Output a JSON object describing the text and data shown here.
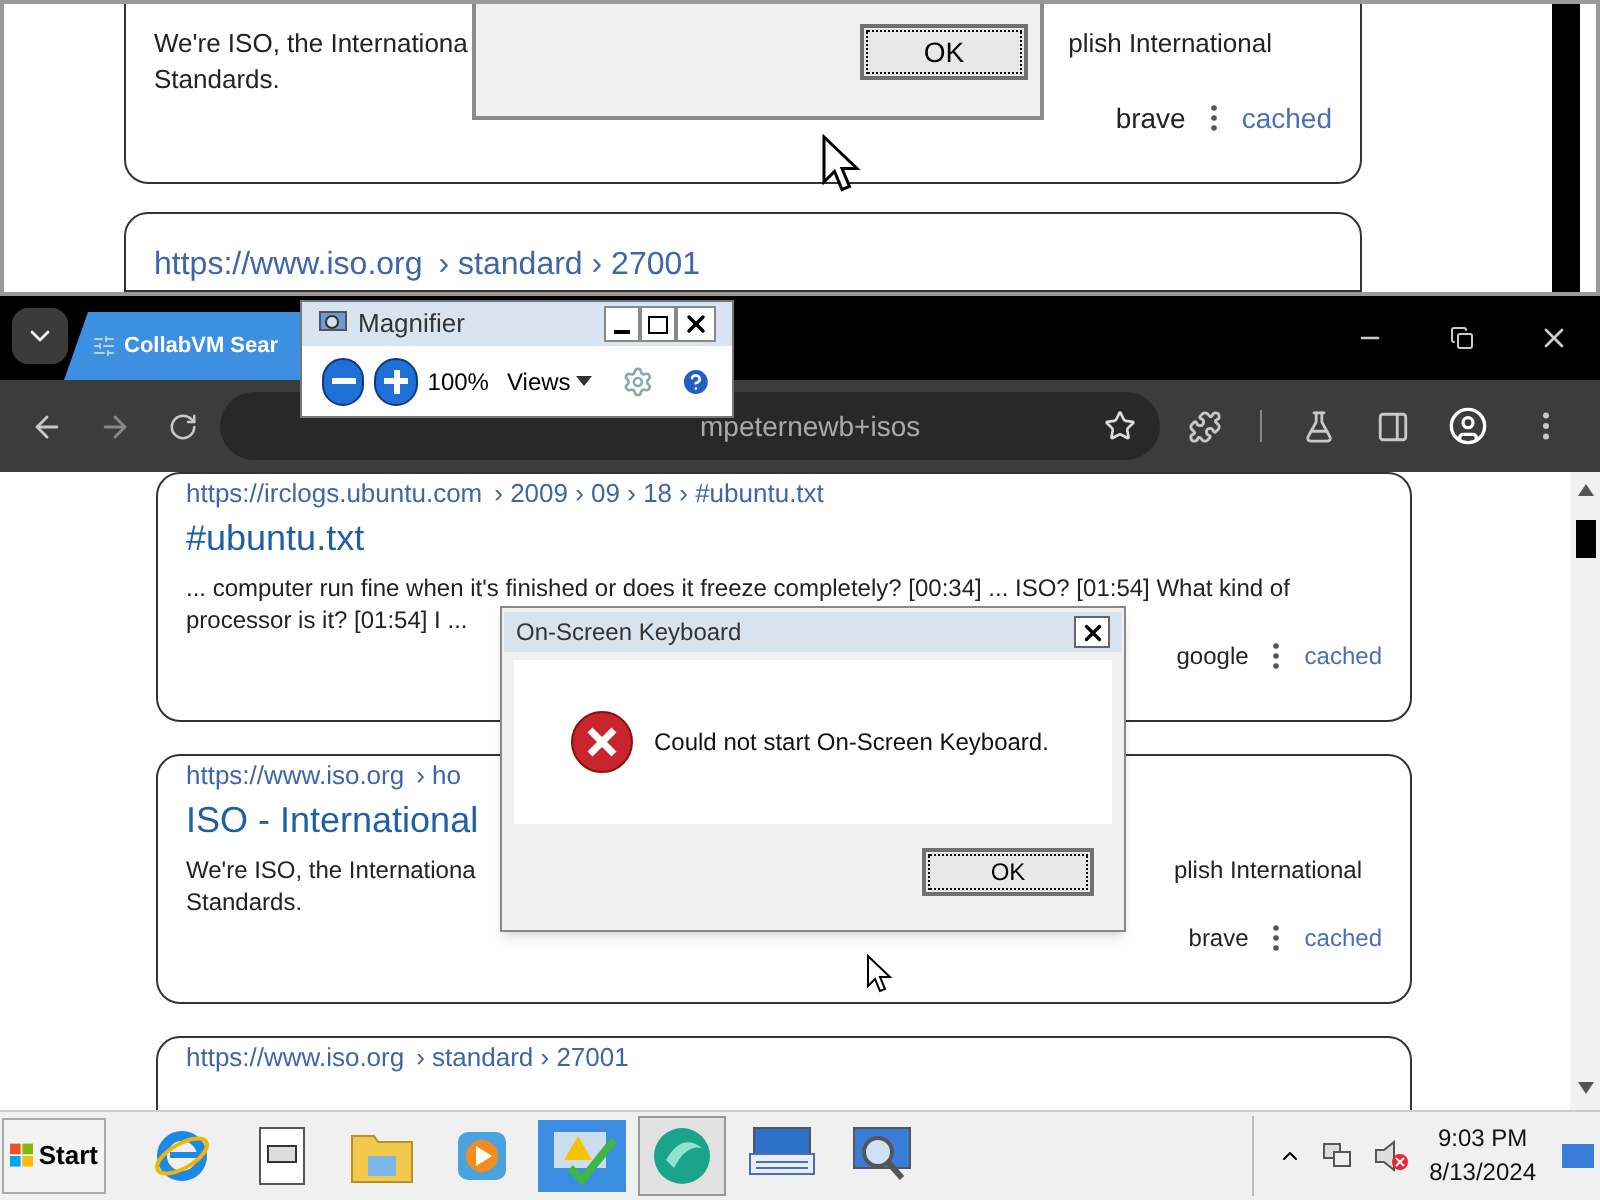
{
  "magnified_view": {
    "card_1": {
      "lines": [
        {
          "left": "We're ISO, the Internationa",
          "right": "plish International"
        },
        {
          "left": "Standards."
        }
      ],
      "source": "brave",
      "cached_link": "cached"
    },
    "dialog_button": "OK",
    "card_2": {
      "url": "https://www.iso.org",
      "breadcrumb": "› standard › 27001"
    }
  },
  "browser": {
    "tab": {
      "title": "CollabVM Sear",
      "selected": true
    },
    "address_text": "mpeternewb+isos"
  },
  "magnifier": {
    "title": "Magnifier",
    "zoom": "100%",
    "views": "Views"
  },
  "results": [
    {
      "url": "https://irclogs.ubuntu.com",
      "breadcrumb": "› 2009 › 09 › 18 › #ubuntu.txt",
      "title": "#ubuntu.txt",
      "lines": [
        {
          "left": "... computer run fine when it's finished or does it freeze completely? [00:34] ... ISO? [01:54] What kind of"
        },
        {
          "left": "processor is it? [01:54] I ..."
        }
      ],
      "source": "google",
      "cached_link": "cached"
    },
    {
      "url": "https://www.iso.org",
      "breadcrumb": "› ho",
      "title": "ISO - International",
      "lines": [
        {
          "left": "We're ISO, the Internationa",
          "right": "plish International"
        },
        {
          "left": "Standards."
        }
      ],
      "source": "brave",
      "cached_link": "cached"
    },
    {
      "url": "https://www.iso.org",
      "breadcrumb": "› standard › 27001"
    }
  ],
  "dialog": {
    "title": "On-Screen Keyboard",
    "message": "Could not start On-Screen Keyboard.",
    "button": "OK"
  },
  "taskbar": {
    "start": "Start",
    "apps": [
      {
        "kind": "browser",
        "selected": false
      },
      {
        "kind": "notepad",
        "selected": false
      },
      {
        "kind": "folder",
        "selected": false
      },
      {
        "kind": "media",
        "selected": false
      },
      {
        "kind": "action",
        "selected": false
      },
      {
        "kind": "orb",
        "selected": true
      },
      {
        "kind": "keyboard",
        "selected": false
      },
      {
        "kind": "magnifier",
        "selected": false
      }
    ],
    "time": "9:03 PM",
    "date": "8/13/2024"
  }
}
